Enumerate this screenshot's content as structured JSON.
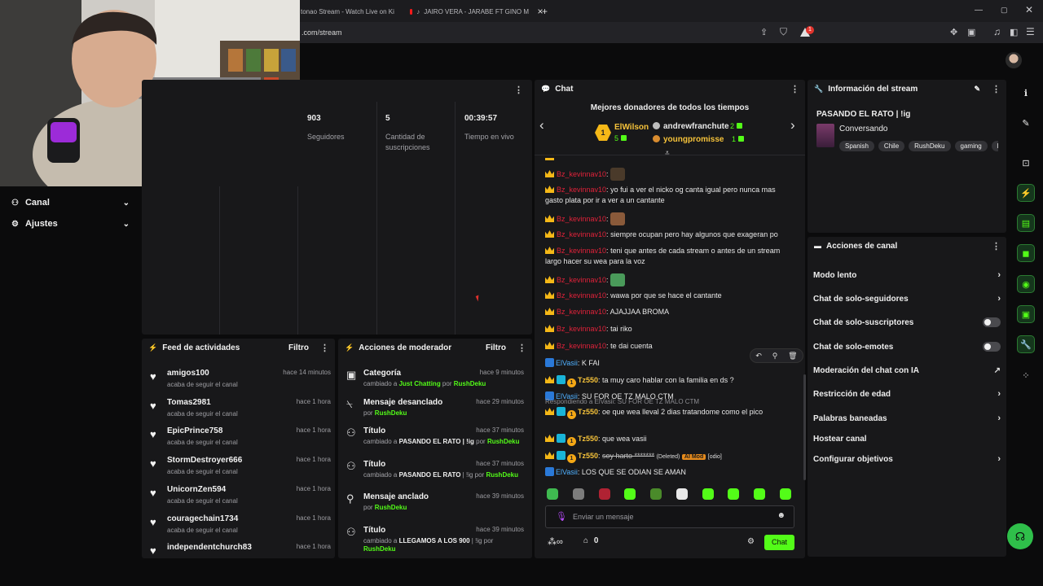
{
  "browser": {
    "tabs": [
      {
        "label": "tonao Stream - Watch Live on Ki"
      },
      {
        "label": "JAIRO VERA - JARABE FT GINO M"
      }
    ],
    "new_tab": "+",
    "url": ".com/stream",
    "notification_count": "1"
  },
  "sidebar": {
    "items": [
      {
        "label": "Canal",
        "icon": "channel-icon"
      },
      {
        "label": "Ajustes",
        "icon": "gear-icon"
      }
    ]
  },
  "stats": [
    {
      "value": "903",
      "label": "Seguidores"
    },
    {
      "value": "5",
      "label": "Cantidad de suscripciones"
    },
    {
      "value": "00:39:57",
      "label": "Tiempo en vivo"
    }
  ],
  "activity_feed": {
    "title": "Feed de actividades",
    "filter": "Filtro",
    "items": [
      {
        "name": "amigos100",
        "sub": "acaba de seguir el canal",
        "time": "hace 14 minutos"
      },
      {
        "name": "Tomas2981",
        "sub": "acaba de seguir el canal",
        "time": "hace 1 hora"
      },
      {
        "name": "EpicPrince758",
        "sub": "acaba de seguir el canal",
        "time": "hace 1 hora"
      },
      {
        "name": "StormDestroyer666",
        "sub": "acaba de seguir el canal",
        "time": "hace 1 hora"
      },
      {
        "name": "UnicornZen594",
        "sub": "acaba de seguir el canal",
        "time": "hace 1 hora"
      },
      {
        "name": "couragechain1734",
        "sub": "acaba de seguir el canal",
        "time": "hace 1 hora"
      },
      {
        "name": "independentchurch83",
        "sub": "",
        "time": "hace 1 hora"
      }
    ]
  },
  "mod_actions": {
    "title": "Acciones de moderador",
    "filter": "Filtro",
    "items": [
      {
        "title": "Categoría",
        "time": "hace 9 minutos",
        "pre": "cambiado a ",
        "value": "Just Chatting",
        "mid": " por ",
        "user": "RushDeku"
      },
      {
        "title": "Mensaje desanclado",
        "time": "hace 29 minutos",
        "pre": "por ",
        "value": "",
        "mid": "",
        "user": "RushDeku"
      },
      {
        "title": "Título",
        "time": "hace 37 minutos",
        "pre": "cambiado a ",
        "value": "PASANDO EL RATO | !ig",
        "mid": " por ",
        "user": "RushDeku"
      },
      {
        "title": "Título",
        "time": "hace 37 minutos",
        "pre": "cambiado a ",
        "value": "PASANDO EL RATO",
        "mid": " | !ig por ",
        "user": "RushDeku"
      },
      {
        "title": "Mensaje anclado",
        "time": "hace 39 minutos",
        "pre": "por ",
        "value": "",
        "mid": "",
        "user": "RushDeku"
      },
      {
        "title": "Título",
        "time": "hace 39 minutos",
        "pre": "cambiado a ",
        "value": "LLEGAMOS A LOS 900",
        "mid": " | !ig por ",
        "user": "RushDeku"
      }
    ]
  },
  "chat": {
    "title": "Chat",
    "donors_title": "Mejores donadores de todos los tiempos",
    "top_donor": {
      "name": "ElWilson",
      "amount": "5"
    },
    "donors": [
      {
        "name": "andrewfranchute",
        "amount": "2"
      },
      {
        "name": "youngpromisse",
        "amount": "1"
      }
    ],
    "messages": [
      {
        "user": "Bz_kevinnav10",
        "text": ""
      },
      {
        "user": "Bz_kevinnav10",
        "text": "yo fui a ver el nicko og canta igual pero nunca mas gasto plata por ir a ver a un cantante"
      },
      {
        "user": "Bz_kevinnav10",
        "text": ""
      },
      {
        "user": "Bz_kevinnav10",
        "text": "siempre ocupan pero hay algunos que exageran po"
      },
      {
        "user": "Bz_kevinnav10",
        "text": "teni que antes de cada stream o antes de un stream largo hacer su wea para la voz"
      },
      {
        "user": "Bz_kevinnav10",
        "text": ""
      },
      {
        "user": "Bz_kevinnav10",
        "text": "wawa por que se hace el cantante"
      },
      {
        "user": "Bz_kevinnav10",
        "text": "AJAJJAA BROMA"
      },
      {
        "user": "Bz_kevinnav10",
        "text": "tai riko"
      },
      {
        "user": "Bz_kevinnav10",
        "text": "te dai cuenta"
      },
      {
        "user": "ElVasii",
        "text": "K FAI"
      },
      {
        "user": "Tz550",
        "text": "ta muy caro hablar con la familia en ds ?"
      },
      {
        "user": "ElVasii",
        "text": "SU FOR OE TZ MALO CTM"
      },
      {
        "reply": "Respondiendo a ElVasii: SU FOR OE TZ MALO CTM",
        "user": "Tz550",
        "text": "oe que wea lleval 2 dias tratandome como el pico"
      },
      {
        "user": "Tz550",
        "text": "que wea vasii"
      },
      {
        "user": "Tz550",
        "text": "soy harto *******",
        "deleted": "(Deleted)",
        "ai_mod": "AI Mod",
        "tag": "[odio]"
      },
      {
        "user": "ElVasii",
        "text": "LOS QUE SE ODIAN SE AMAN"
      }
    ],
    "input_placeholder": "Enviar un mensaje",
    "points": "0",
    "send_label": "Chat"
  },
  "stream_info": {
    "title": "Información del stream",
    "stream_title": "PASANDO EL RATO | !ig",
    "category": "Conversando",
    "tags": [
      "Spanish",
      "Chile",
      "RushDeku",
      "gaming",
      "ki"
    ]
  },
  "channel_actions": {
    "title": "Acciones de canal",
    "items": [
      {
        "label": "Modo lento",
        "control": "chevron"
      },
      {
        "label": "Chat de solo-seguidores",
        "control": "chevron"
      },
      {
        "label": "Chat de solo-suscriptores",
        "control": "toggle"
      },
      {
        "label": "Chat de solo-emotes",
        "control": "toggle"
      },
      {
        "label": "Moderación del chat con IA",
        "control": "external"
      },
      {
        "label": "Restricción de edad",
        "control": "chevron"
      },
      {
        "label": "Palabras baneadas",
        "control": "chevron"
      },
      {
        "label": "Hostear canal",
        "control": "none"
      },
      {
        "label": "Configurar objetivos",
        "control": "chevron"
      }
    ]
  },
  "colors": {
    "accent": "#53fc18",
    "panel": "#18181a",
    "username_red": "#e0223a"
  }
}
